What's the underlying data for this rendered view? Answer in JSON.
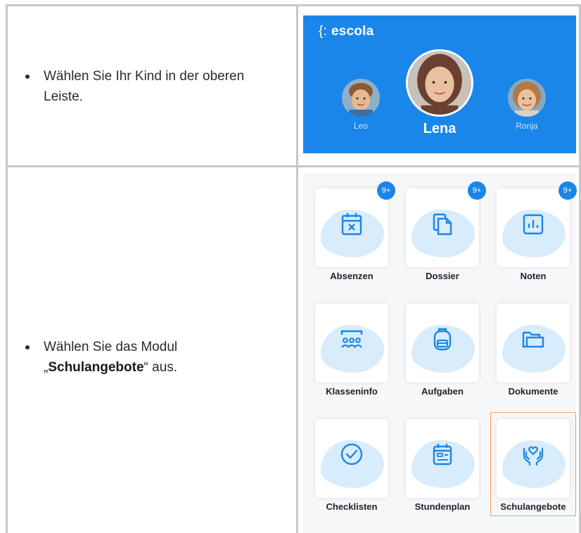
{
  "rows": [
    {
      "instruction": "Wählen Sie Ihr Kind in der oberen Leiste."
    },
    {
      "instruction_prefix": "Wählen Sie das Modul „",
      "instruction_bold": "Schulangebote",
      "instruction_suffix": "“ aus."
    }
  ],
  "app": {
    "brand": "escola",
    "brand_symbol": "{:",
    "accent_color": "#1a86ea",
    "children": [
      {
        "name": "Leo",
        "selected": false
      },
      {
        "name": "Lena",
        "selected": true
      },
      {
        "name": "Ronja",
        "selected": false
      }
    ]
  },
  "modules": [
    {
      "label": "Absenzen",
      "icon": "calendar-x-icon",
      "badge": "9+"
    },
    {
      "label": "Dossier",
      "icon": "documents-icon",
      "badge": "9+"
    },
    {
      "label": "Noten",
      "icon": "bar-chart-icon",
      "badge": "9+"
    },
    {
      "label": "Klasseninfo",
      "icon": "group-icon",
      "badge": ""
    },
    {
      "label": "Aufgaben",
      "icon": "backpack-icon",
      "badge": ""
    },
    {
      "label": "Dokumente",
      "icon": "folder-icon",
      "badge": ""
    },
    {
      "label": "Checklisten",
      "icon": "check-circle-icon",
      "badge": ""
    },
    {
      "label": "Stundenplan",
      "icon": "timetable-icon",
      "badge": ""
    },
    {
      "label": "Schulangebote",
      "icon": "heart-hands-icon",
      "badge": "",
      "highlighted": true
    }
  ]
}
